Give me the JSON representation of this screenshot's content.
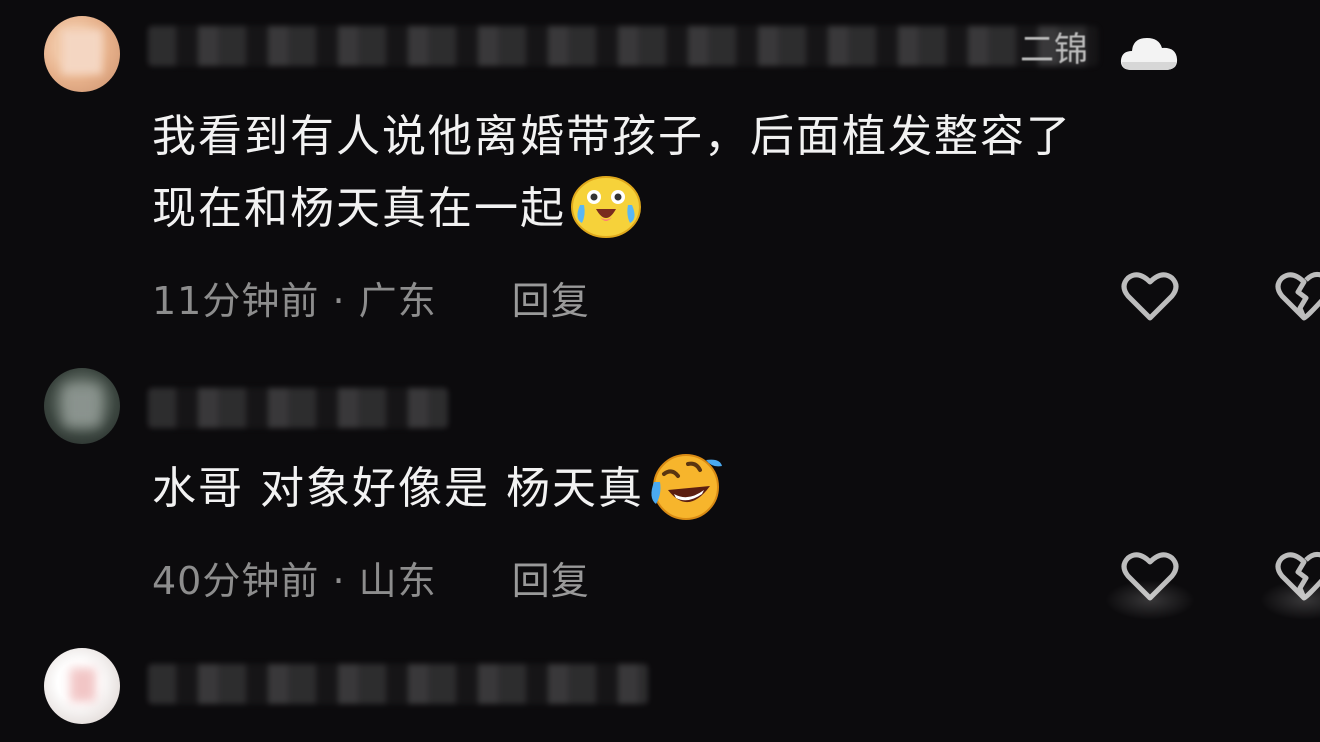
{
  "comments": [
    {
      "username_visible": "二锦",
      "text_line1": "我看到有人说他离婚带孩子，后面植发整容了",
      "text_line2": "现在和杨天真在一起",
      "emoji_icon": "laughing-crying-face-icon",
      "time": "11分钟前",
      "location": "广东",
      "separator": "·",
      "reply_label": "回复"
    },
    {
      "text": "水哥  对象好像是 杨天真",
      "emoji_icon": "rolling-laughing-face-icon",
      "time": "40分钟前",
      "location": "山东",
      "separator": "·",
      "reply_label": "回复"
    }
  ],
  "colors": {
    "background": "#0c0b0d",
    "text": "#f2f2f2",
    "meta": "#8d8d8d"
  }
}
